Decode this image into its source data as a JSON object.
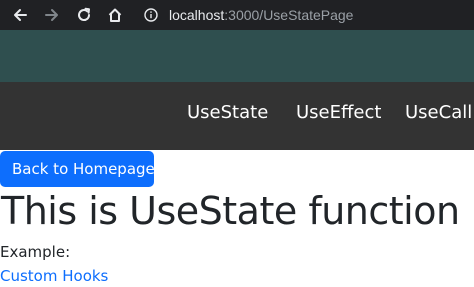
{
  "browser": {
    "url_host": "localhost",
    "url_path": ":3000/UseStatePage",
    "icons": [
      "back-arrow-icon",
      "forward-arrow-icon",
      "reload-icon",
      "home-icon",
      "info-icon"
    ]
  },
  "colors": {
    "browser_bar": "#202124",
    "header_band": "#2f4f4f",
    "navbar": "#333333",
    "primary": "#0d6efd",
    "text": "#212529"
  },
  "navbar": {
    "links": [
      {
        "label": "UseState"
      },
      {
        "label": "UseEffect"
      },
      {
        "label": "UseCallB"
      }
    ]
  },
  "main": {
    "back_button_label": "Back to Homepage",
    "title": "This is UseState function",
    "example_label": "Example:",
    "custom_hooks_link": "Custom Hooks"
  }
}
